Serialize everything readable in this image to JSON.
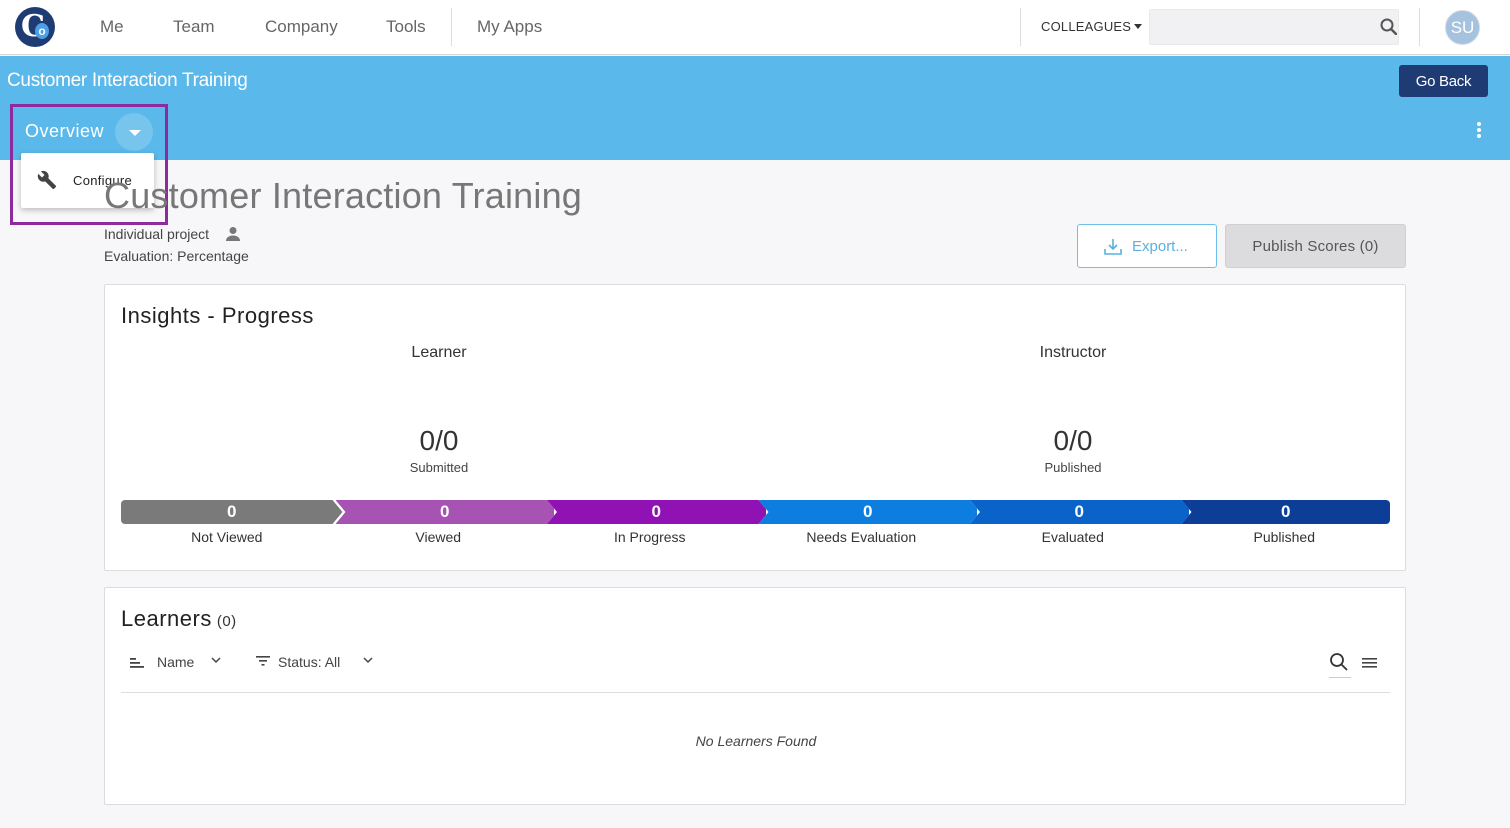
{
  "nav": {
    "logo_letters": "Co",
    "items": [
      "Me",
      "Team",
      "Company",
      "Tools",
      "My Apps"
    ],
    "colleagues_label": "COLLEAGUES",
    "search_placeholder": "",
    "avatar_initials": "SU"
  },
  "header": {
    "course_title": "Customer Interaction Training",
    "go_back_label": "Go Back",
    "view_label": "Overview",
    "dropdown_items": [
      {
        "label": "Configure",
        "icon": "wrench-icon"
      }
    ]
  },
  "page": {
    "title": "Customer Interaction Training",
    "project_type": "Individual project",
    "evaluation": "Evaluation: Percentage",
    "export_label": "Export...",
    "publish_label": "Publish Scores (0)"
  },
  "insights": {
    "title": "Insights - Progress",
    "learner": {
      "label": "Learner",
      "value": "0/0",
      "sub": "Submitted"
    },
    "instructor": {
      "label": "Instructor",
      "value": "0/0",
      "sub": "Published"
    },
    "stages": [
      {
        "label": "Not Viewed",
        "value": "0",
        "color": "#7a7a7a"
      },
      {
        "label": "Viewed",
        "value": "0",
        "color": "#a653b3"
      },
      {
        "label": "In Progress",
        "value": "0",
        "color": "#9012b4"
      },
      {
        "label": "Needs Evaluation",
        "value": "0",
        "color": "#0d7ee0"
      },
      {
        "label": "Evaluated",
        "value": "0",
        "color": "#0a63c8"
      },
      {
        "label": "Published",
        "value": "0",
        "color": "#0c3e98"
      }
    ]
  },
  "learners": {
    "title": "Learners",
    "count": "(0)",
    "sort_label": "Name",
    "filter_label": "Status:  All",
    "empty_message": "No Learners Found"
  }
}
